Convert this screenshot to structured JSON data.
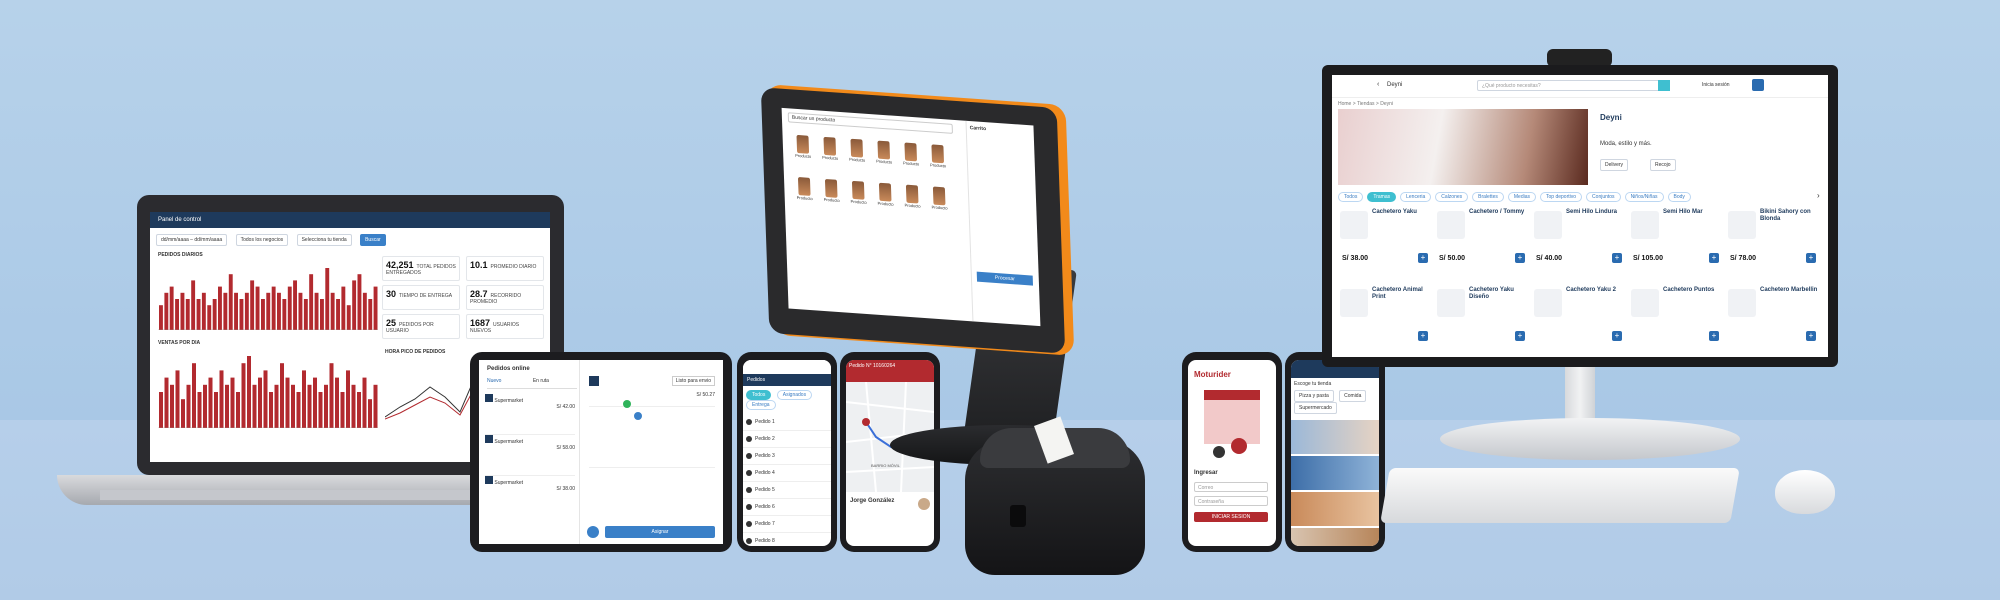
{
  "colors": {
    "brand_blue": "#1e3a5c",
    "accent_red": "#b22a2f",
    "pos_orange": "#f28a1a",
    "cyan": "#3fbfd0",
    "primary": "#2a6bb0"
  },
  "laptop": {
    "header": "Panel de control",
    "filter_date": "dd/mm/aaaa – dd/mm/aaaa",
    "filter_select": "Todos los negocios",
    "filter_business": "Selecciona tu tienda",
    "filter_button": "Buscar",
    "chart1_title": "PEDIDOS DIARIOS",
    "chart2_title": "VENTAS POR DIA",
    "chart3_title": "HORA PICO DE PEDIDOS",
    "kpis": [
      {
        "value": "42,251",
        "label": "TOTAL PEDIDOS ENTREGADOS"
      },
      {
        "value": "10.1",
        "label": "PROMEDIO DIARIO"
      },
      {
        "value": "30",
        "label": "TIEMPO DE ENTREGA"
      },
      {
        "value": "28.7",
        "label": "RECORRIDO PROMEDIO"
      },
      {
        "value": "25",
        "label": "PEDIDOS POR USUARIO"
      },
      {
        "value": "1687",
        "label": "USUARIOS NUEVOS"
      }
    ],
    "chart_data": {
      "type": "bar",
      "series": [
        {
          "values": [
            4,
            6,
            7,
            5,
            6,
            5,
            8,
            5,
            6,
            4,
            5,
            7,
            6,
            9,
            6,
            5,
            6,
            8,
            7,
            5,
            6,
            7,
            6,
            5,
            7,
            8,
            6,
            5,
            9,
            6,
            5,
            10,
            6,
            5,
            7,
            4,
            8,
            9,
            6,
            5,
            7
          ]
        },
        {
          "values": [
            5,
            7,
            6,
            8,
            4,
            6,
            9,
            5,
            6,
            7,
            5,
            8,
            6,
            7,
            5,
            9,
            10,
            6,
            7,
            8,
            5,
            6,
            9,
            7,
            6,
            5,
            8,
            6,
            7,
            5,
            6,
            9,
            7,
            5,
            8,
            6,
            5,
            7,
            4,
            6
          ]
        }
      ]
    }
  },
  "tablet": {
    "title": "Pedidos online",
    "tabs": [
      "Nuevo",
      "En ruta"
    ],
    "orders": [
      {
        "name": "Supermarket",
        "total": "S/ 42.00"
      },
      {
        "name": "Supermarket",
        "total": "S/ 58.00"
      },
      {
        "name": "Supermarket",
        "total": "S/ 38.00"
      }
    ],
    "detail_status": "Listo para envio",
    "detail_total": "S/ 50.27",
    "button": "Asignar"
  },
  "phone1": {
    "header": "Pedidos",
    "tabs": [
      "Todos",
      "Asignados",
      "Entrega"
    ],
    "items": [
      "Pedido 1",
      "Pedido 2",
      "Pedido 3",
      "Pedido 4",
      "Pedido 5",
      "Pedido 6",
      "Pedido 7",
      "Pedido 8"
    ]
  },
  "phone2": {
    "header": "Pedido N° 10160264",
    "driver": "Jorge González",
    "map_label": "BARRIO MÓVIL"
  },
  "phone3": {
    "brand": "Moturider",
    "greeting": "Ingresar",
    "field1": "Correo",
    "field2": "Contraseña",
    "button": "INICIAR SESION"
  },
  "phone4": {
    "header": "Escoge tu tienda",
    "chips": [
      "Pizza y pasta",
      "Comida",
      "Supermercado"
    ]
  },
  "pos": {
    "search": "Buscar un producto",
    "panel_title": "Carrito",
    "button": "Procesar",
    "products": [
      "Producto",
      "Producto",
      "Producto",
      "Producto",
      "Producto",
      "Producto",
      "Producto",
      "Producto",
      "Producto",
      "Producto",
      "Producto",
      "Producto"
    ]
  },
  "monitor": {
    "store": "Deyni",
    "search_placeholder": "¿Qué producto necesitas?",
    "login": "Inicia sesión",
    "breadcrumb": "Home  >  Tiendas  >  Deyni",
    "store_name": "Deyni",
    "store_desc": "Moda, estilo y más.",
    "store_hours": "Delivery",
    "store_pickup": "Recojo",
    "categories": [
      "Todos",
      "Tramas",
      "Lenceria",
      "Calzones",
      "Bralettes",
      "Medias",
      "Top deportivo",
      "Conjuntos",
      "Niños/Niñas",
      "Body"
    ],
    "products": [
      {
        "name": "Cachetero Yaku",
        "price": "S/ 38.00"
      },
      {
        "name": "Cachetero / Tommy",
        "price": "S/ 50.00"
      },
      {
        "name": "Semi Hilo Lindura",
        "price": "S/ 40.00"
      },
      {
        "name": "Semi Hilo Mar",
        "price": "S/ 105.00"
      },
      {
        "name": "Bikini Sahory con Blonda",
        "price": "S/ 78.00"
      },
      {
        "name": "Cachetero Animal Print",
        "price": ""
      },
      {
        "name": "Cachetero Yaku Diseño",
        "price": ""
      },
      {
        "name": "Cachetero Yaku 2",
        "price": ""
      },
      {
        "name": "Cachetero Puntos",
        "price": ""
      },
      {
        "name": "Cachetero Marbellin",
        "price": ""
      }
    ]
  }
}
